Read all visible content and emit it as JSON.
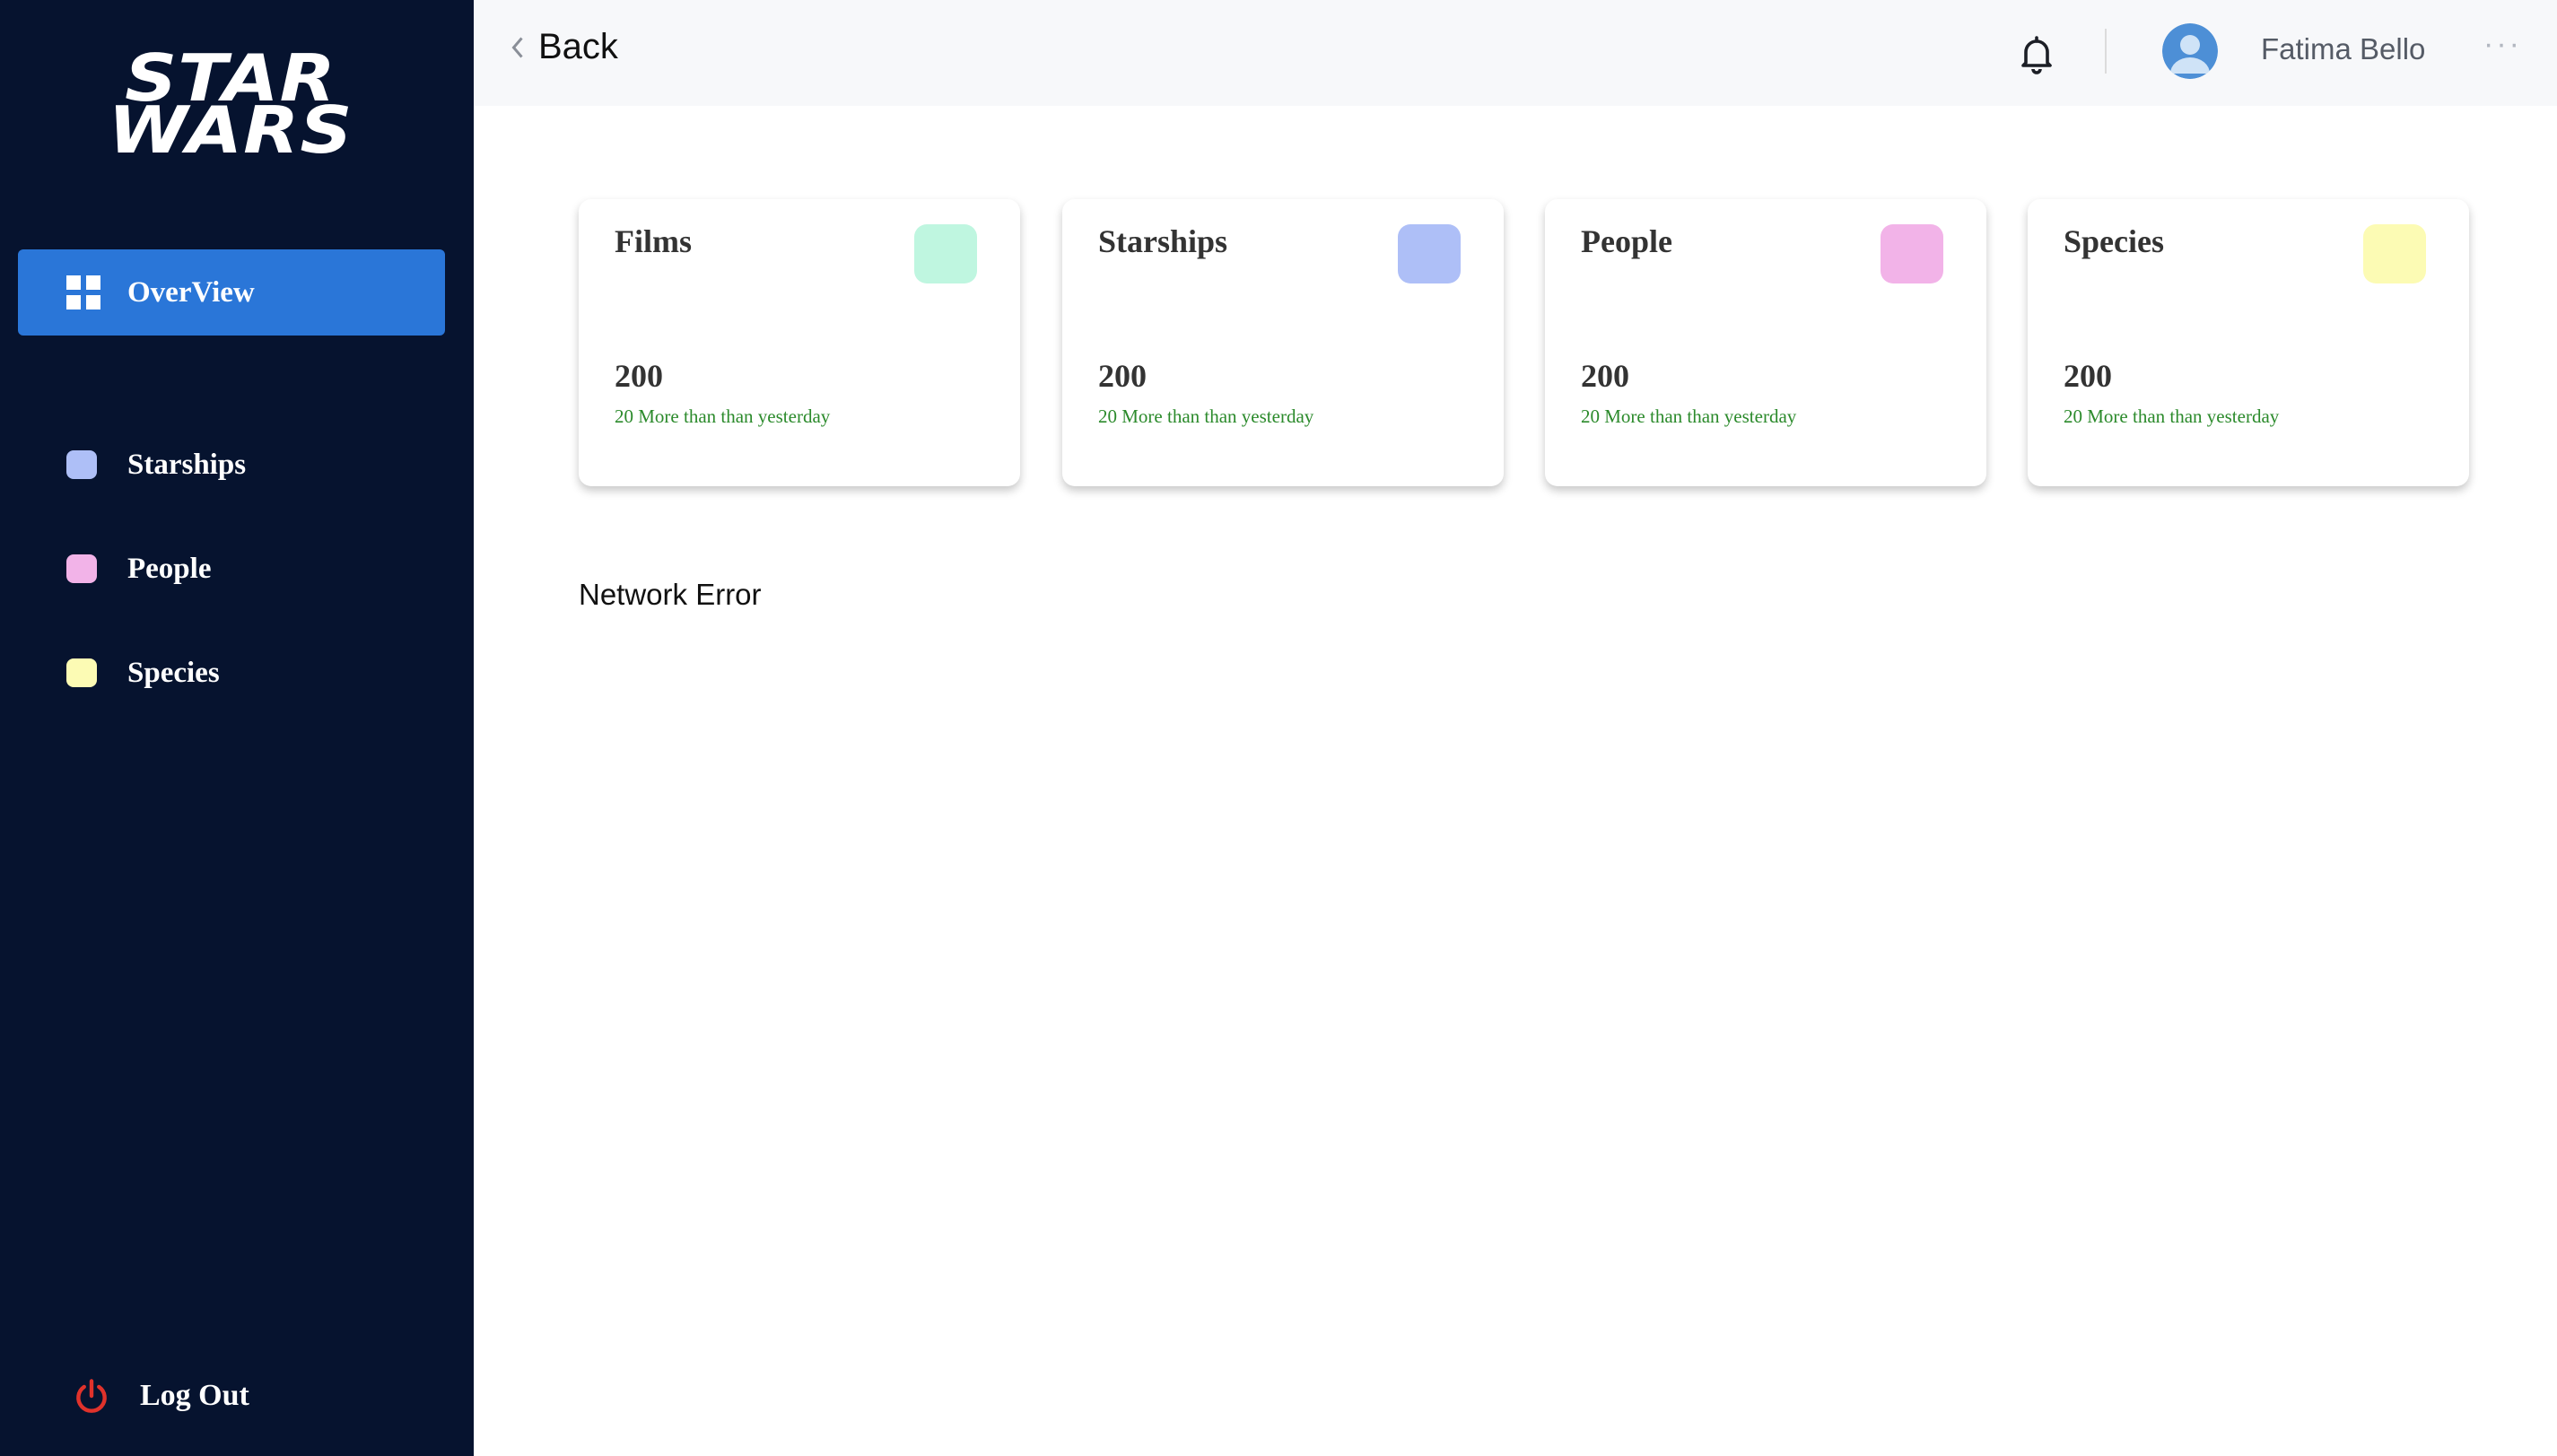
{
  "brand": {
    "logo_line1": "STAR",
    "logo_line2": "WARS"
  },
  "colors": {
    "sidebar_bg": "#06132f",
    "accent": "#2a76d8",
    "films": "#bff6e0",
    "starships": "#aebff7",
    "people": "#f2b3e8",
    "species": "#fcfbb4",
    "positive": "#2b8a2b",
    "logout_icon": "#e0322b"
  },
  "sidebar": {
    "active": {
      "label": "OverView",
      "icon": "grid-icon"
    },
    "items": [
      {
        "label": "Starships",
        "color": "#aebff7"
      },
      {
        "label": "People",
        "color": "#f2b3e8"
      },
      {
        "label": "Species",
        "color": "#fcfbb4"
      }
    ],
    "logout_label": "Log Out"
  },
  "header": {
    "back_label": "Back",
    "user_name": "Fatima Bello",
    "more_label": "···"
  },
  "cards": [
    {
      "title": "Films",
      "count": "200",
      "delta": "20 More than than yesterday",
      "color": "#bff6e0"
    },
    {
      "title": "Starships",
      "count": "200",
      "delta": "20 More than than yesterday",
      "color": "#aebff7"
    },
    {
      "title": "People",
      "count": "200",
      "delta": "20 More than than yesterday",
      "color": "#f2b3e8"
    },
    {
      "title": "Species",
      "count": "200",
      "delta": "20 More than than yesterday",
      "color": "#fcfbb4"
    }
  ],
  "status_message": "Network Error"
}
